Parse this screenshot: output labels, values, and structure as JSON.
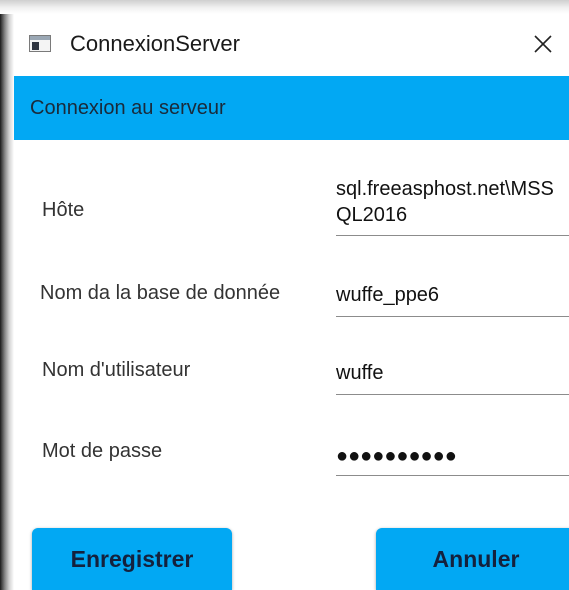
{
  "window": {
    "title": "ConnexionServer",
    "close_glyph": "✕"
  },
  "header": {
    "title": "Connexion au serveur"
  },
  "form": {
    "host": {
      "label": "Hôte",
      "value": "sql.freeasphost.net\\MSSQL2016"
    },
    "database": {
      "label": "Nom da la base de donnée",
      "value": "wuffe_ppe6"
    },
    "username": {
      "label": "Nom d'utilisateur",
      "value": "wuffe"
    },
    "password": {
      "label": "Mot de passe",
      "masked": "●●●●●●●●●●"
    }
  },
  "actions": {
    "save_label": "Enregistrer",
    "cancel_label": "Annuler"
  },
  "colors": {
    "accent": "#02a8f3",
    "text": "#333333"
  },
  "icons": {
    "app": "window-app-icon",
    "close": "close-icon"
  }
}
